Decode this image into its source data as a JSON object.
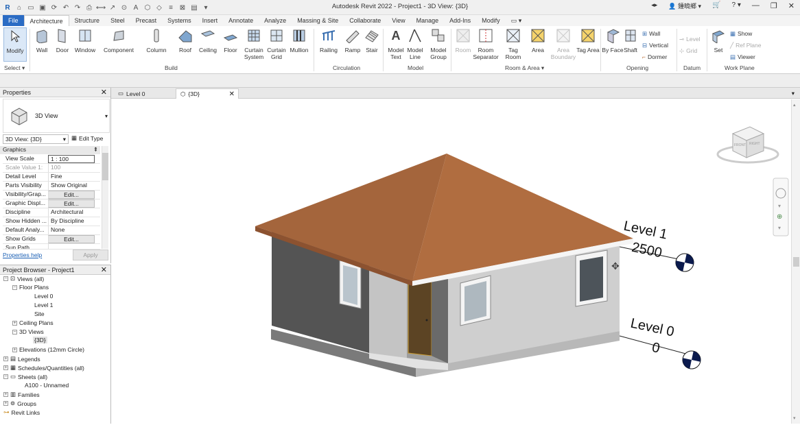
{
  "app": {
    "title": "Autodesk Revit 2022 - Project1 - 3D View: {3D}",
    "user": "鍾曉鄉",
    "help": "?"
  },
  "colors": {
    "file_tab": "#2b6cc4",
    "roof": "#a9683e",
    "wall_light": "#cfcfcf",
    "wall_dark": "#545454",
    "door": "#5c4424"
  },
  "tabs": [
    "File",
    "Architecture",
    "Structure",
    "Steel",
    "Precast",
    "Systems",
    "Insert",
    "Annotate",
    "Analyze",
    "Massing & Site",
    "Collaborate",
    "View",
    "Manage",
    "Add-Ins",
    "Modify"
  ],
  "ribbon": {
    "select": {
      "modify": "Modify",
      "select_label": "Select ▾"
    },
    "build": {
      "label": "Build",
      "wall": "Wall",
      "door": "Door",
      "window": "Window",
      "component": "Component",
      "column": "Column",
      "roof": "Roof",
      "ceiling": "Ceiling",
      "floor": "Floor",
      "curtain_system": "Curtain System",
      "curtain_grid": "Curtain Grid",
      "mullion": "Mullion"
    },
    "circulation": {
      "label": "Circulation",
      "railing": "Railing",
      "ramp": "Ramp",
      "stair": "Stair"
    },
    "model": {
      "label": "Model",
      "model_text": "Model Text",
      "model_line": "Model Line",
      "model_group": "Model Group"
    },
    "room_area": {
      "label": "Room & Area ▾",
      "room": "Room",
      "room_separator": "Room Separator",
      "tag_room": "Tag Room",
      "area": "Area",
      "area_boundary": "Area Boundary",
      "tag_area": "Tag Area"
    },
    "opening": {
      "label": "Opening",
      "by_face": "By Face",
      "shaft": "Shaft",
      "wall": "Wall",
      "vertical": "Vertical",
      "dormer": "Dormer"
    },
    "datum": {
      "label": "Datum",
      "level": "Level",
      "grid": "Grid"
    },
    "work_plane": {
      "label": "Work Plane",
      "set": "Set",
      "show": "Show",
      "ref_plane": "Ref Plane",
      "viewer": "Viewer"
    }
  },
  "properties": {
    "title": "Properties",
    "type_name": "3D View",
    "instance": "3D View: {3D}",
    "edit_type": "Edit Type",
    "group": "Graphics",
    "rows": [
      {
        "k": "View Scale",
        "v": "1 : 100"
      },
      {
        "k": "Scale Value    1:",
        "v": "100"
      },
      {
        "k": "Detail Level",
        "v": "Fine"
      },
      {
        "k": "Parts Visibility",
        "v": "Show Original"
      },
      {
        "k": "Visibility/Grap...",
        "v": "Edit..."
      },
      {
        "k": "Graphic Displ...",
        "v": "Edit..."
      },
      {
        "k": "Discipline",
        "v": "Architectural"
      },
      {
        "k": "Show Hidden ...",
        "v": "By Discipline"
      },
      {
        "k": "Default Analy...",
        "v": "None"
      },
      {
        "k": "Show Grids",
        "v": "Edit..."
      },
      {
        "k": "Sun Path",
        "v": ""
      }
    ],
    "help_link": "Properties help",
    "apply": "Apply"
  },
  "browser": {
    "title": "Project Browser - Project1",
    "nodes": [
      {
        "label": "Views (all)"
      },
      {
        "label": "Floor Plans"
      },
      {
        "label": "Level 0"
      },
      {
        "label": "Level 1"
      },
      {
        "label": "Site"
      },
      {
        "label": "Ceiling Plans"
      },
      {
        "label": "3D Views"
      },
      {
        "label": "{3D}"
      },
      {
        "label": "Elevations (12mm Circle)"
      },
      {
        "label": "Legends"
      },
      {
        "label": "Schedules/Quantities (all)"
      },
      {
        "label": "Sheets (all)"
      },
      {
        "label": "A100 - Unnamed"
      },
      {
        "label": "Families"
      },
      {
        "label": "Groups"
      },
      {
        "label": "Revit Links"
      }
    ]
  },
  "view_tabs": [
    {
      "label": "Level 0"
    },
    {
      "label": "{3D}"
    }
  ],
  "viewcube": {
    "front": "FRONT",
    "right": "RIGHT"
  },
  "levels": [
    {
      "name": "Level 1",
      "elevation": "2500"
    },
    {
      "name": "Level 0",
      "elevation": "0"
    }
  ]
}
